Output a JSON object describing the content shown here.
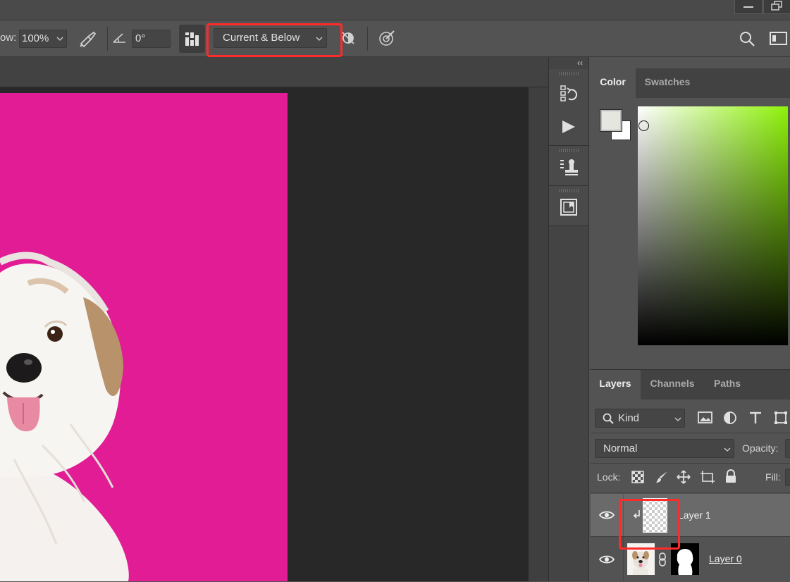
{
  "titlebar": {
    "minimize_icon": "minimize-icon",
    "restore_icon": "restore-icon"
  },
  "options_bar": {
    "flow_label": "ow:",
    "flow_value": "100%",
    "angle_value": "0°",
    "sample_mode": "Current & Below",
    "icons": [
      "airbrush-icon",
      "angle-icon",
      "brush-settings-icon",
      "ignore-adjustment-layers-icon",
      "pressure-size-icon",
      "search-icon",
      "workspace-icon"
    ]
  },
  "dock": {
    "collapse_label": "‹‹",
    "buttons": [
      "history-icon",
      "actions-play-icon",
      "clone-source-icon",
      "properties-icon"
    ]
  },
  "color_panel": {
    "tabs": [
      "Color",
      "Swatches"
    ],
    "active_tab": "Color",
    "foreground_color": "#e6e6e0",
    "background_color": "#ffffff",
    "hue_color": "#8ef20a"
  },
  "layers_panel": {
    "tabs": [
      "Layers",
      "Channels",
      "Paths"
    ],
    "active_tab": "Layers",
    "filter_kind": "Kind",
    "blend_mode": "Normal",
    "opacity_label": "Opacity:",
    "lock_label": "Lock:",
    "fill_label": "Fill:",
    "layers": [
      {
        "name": "Layer 1",
        "clipped": true,
        "visible": true,
        "selected": true
      },
      {
        "name": "Layer 0",
        "clipped": false,
        "visible": true,
        "selected": false,
        "has_mask": true
      }
    ]
  },
  "canvas": {
    "background_color": "#e11c94"
  }
}
